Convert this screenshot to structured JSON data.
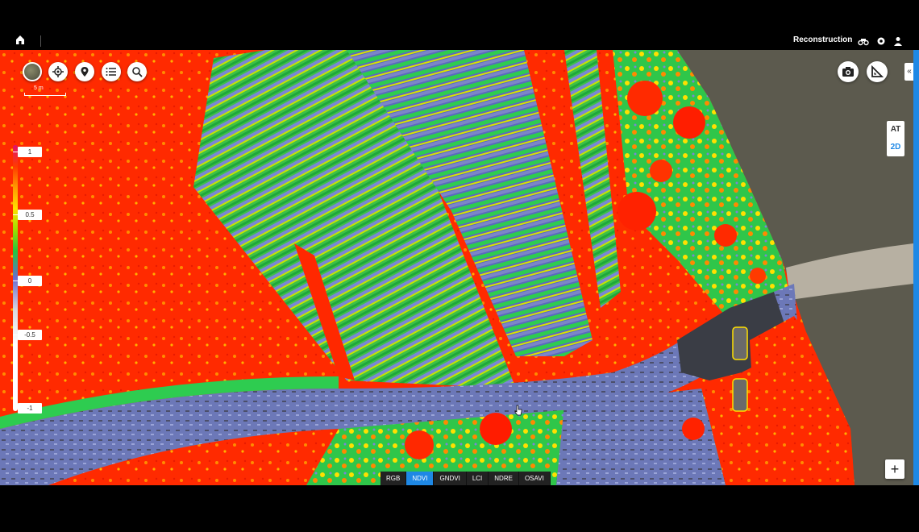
{
  "app": {
    "title": "Reconstruction"
  },
  "map": {
    "scale_label": "5 m",
    "legend": {
      "ticks": [
        "1",
        "0.5",
        "0",
        "-0.5",
        "-1"
      ]
    },
    "view_toggle": {
      "at": "AT",
      "two_d": "2D"
    },
    "zoom_in": "+",
    "collapse": "«"
  },
  "index_tabs": [
    {
      "label": "RGB",
      "active": false
    },
    {
      "label": "NDVI",
      "active": true
    },
    {
      "label": "GNDVI",
      "active": false
    },
    {
      "label": "LCI",
      "active": false
    },
    {
      "label": "NDRE",
      "active": false
    },
    {
      "label": "OSAVI",
      "active": false
    }
  ],
  "colors": {
    "accent": "#1e88e5",
    "ndvi_high": "#ff2a00",
    "ndvi_mid": "#22c640",
    "ndvi_low": "#6a7ad0"
  }
}
